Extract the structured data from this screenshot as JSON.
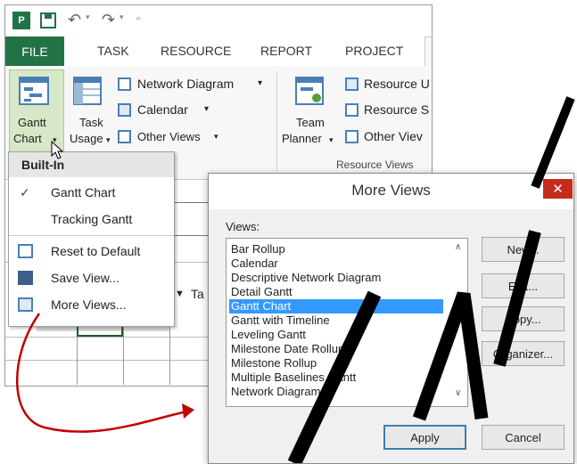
{
  "ribbon": {
    "tabs": [
      "FILE",
      "TASK",
      "RESOURCE",
      "REPORT",
      "PROJECT"
    ],
    "gantt_chart_line1": "Gantt",
    "gantt_chart_line2": "Chart",
    "task_usage_line1": "Task",
    "task_usage_line2": "Usage",
    "network_diagram": "Network Diagram",
    "calendar": "Calendar",
    "other_views": "Other Views",
    "team_planner_line1": "Team",
    "team_planner_line2": "Planner",
    "resource_usage": "Resource U",
    "resource_sheet": "Resource S",
    "other_views_right": "Other Viev",
    "group_resource_views": "Resource Views"
  },
  "menu": {
    "header": "Built-In",
    "items": [
      "Gantt Chart",
      "Tracking Gantt"
    ],
    "actions": [
      "Reset to Default",
      "Save View...",
      "More Views..."
    ],
    "partial_column": "Ta"
  },
  "dialog": {
    "title": "More Views",
    "close": "✕",
    "views_label": "Views:",
    "views": [
      "Bar Rollup",
      "Calendar",
      "Descriptive Network Diagram",
      "Detail Gantt",
      "Gantt Chart",
      "Gantt with Timeline",
      "Leveling Gantt",
      "Milestone Date Rollup",
      "Milestone Rollup",
      "Multiple Baselines Gantt",
      "Network Diagram"
    ],
    "selected_view": "Gantt Chart",
    "buttons": {
      "new": "New...",
      "edit": "Edit...",
      "copy": "Copy...",
      "organizer": "Organizer...",
      "apply": "Apply",
      "cancel": "Cancel"
    }
  },
  "colors": {
    "file_tab": "#217346",
    "selection": "#3399ff",
    "arrow": "#c00000",
    "close": "#c42b1c"
  }
}
